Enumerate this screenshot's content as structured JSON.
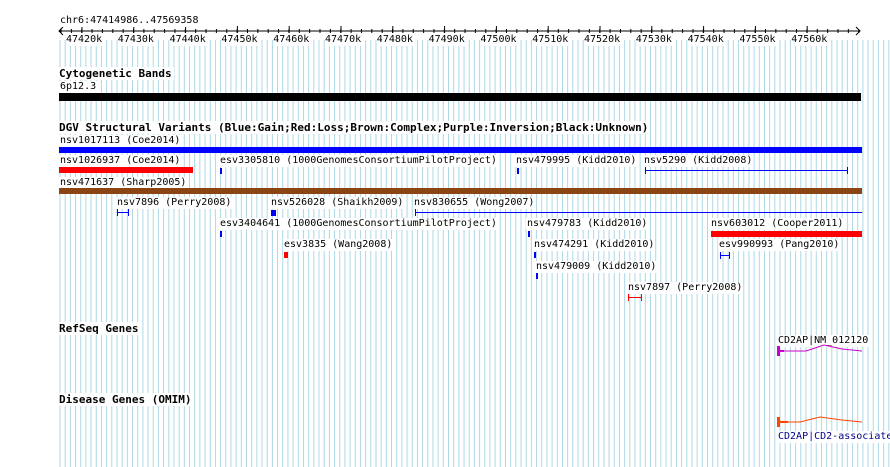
{
  "colors": {
    "grid": "#add8e6",
    "blue": "#0000ff",
    "red": "#ff0000",
    "brown": "#8b4513",
    "magenta": "#cc00cc",
    "orange_red": "#ff4500",
    "black": "#000000"
  },
  "ruler": {
    "coordinates": "chr6:47414986..47569358",
    "ticks": [
      "47420k",
      "47430k",
      "47440k",
      "47450k",
      "47460k",
      "47470k",
      "47480k",
      "47490k",
      "47500k",
      "47510k",
      "47520k",
      "47530k",
      "47540k",
      "47550k",
      "47560k"
    ]
  },
  "cytoband": {
    "title": "Cytogenetic Bands",
    "band_label": "6p12.3"
  },
  "dgv": {
    "title": "DGV Structural Variants (Blue:Gain;Red:Loss;Brown:Complex;Purple:Inversion;Black:Unknown)",
    "labels": {
      "nsv1017113": "nsv1017113 (Coe2014)",
      "nsv1026937": "nsv1026937 (Coe2014)",
      "esv3305810": "esv3305810 (1000GenomesConsortiumPilotProject)",
      "nsv479995": "nsv479995 (Kidd2010)",
      "nsv5290": "nsv5290 (Kidd2008)",
      "nsv471637": "nsv471637 (Sharp2005)",
      "nsv7896": "nsv7896 (Perry2008)",
      "nsv526028": "nsv526028 (Shaikh2009)",
      "nsv830655": "nsv830655 (Wong2007)",
      "esv3404641": "esv3404641 (1000GenomesConsortiumPilotProject)",
      "nsv479783": "nsv479783 (Kidd2010)",
      "nsv603012": "nsv603012 (Cooper2011)",
      "esv3835": "esv3835 (Wang2008)",
      "nsv474291": "nsv474291 (Kidd2010)",
      "esv990993": "esv990993 (Pang2010)",
      "nsv479009": "nsv479009 (Kidd2010)",
      "nsv7897": "nsv7897 (Perry2008)"
    }
  },
  "refseq": {
    "title": "RefSeq Genes",
    "gene_label": "CD2AP|NM_012120"
  },
  "omim": {
    "title": "Disease Genes (OMIM)",
    "gene_label": "CD2AP|CD2-associate"
  }
}
